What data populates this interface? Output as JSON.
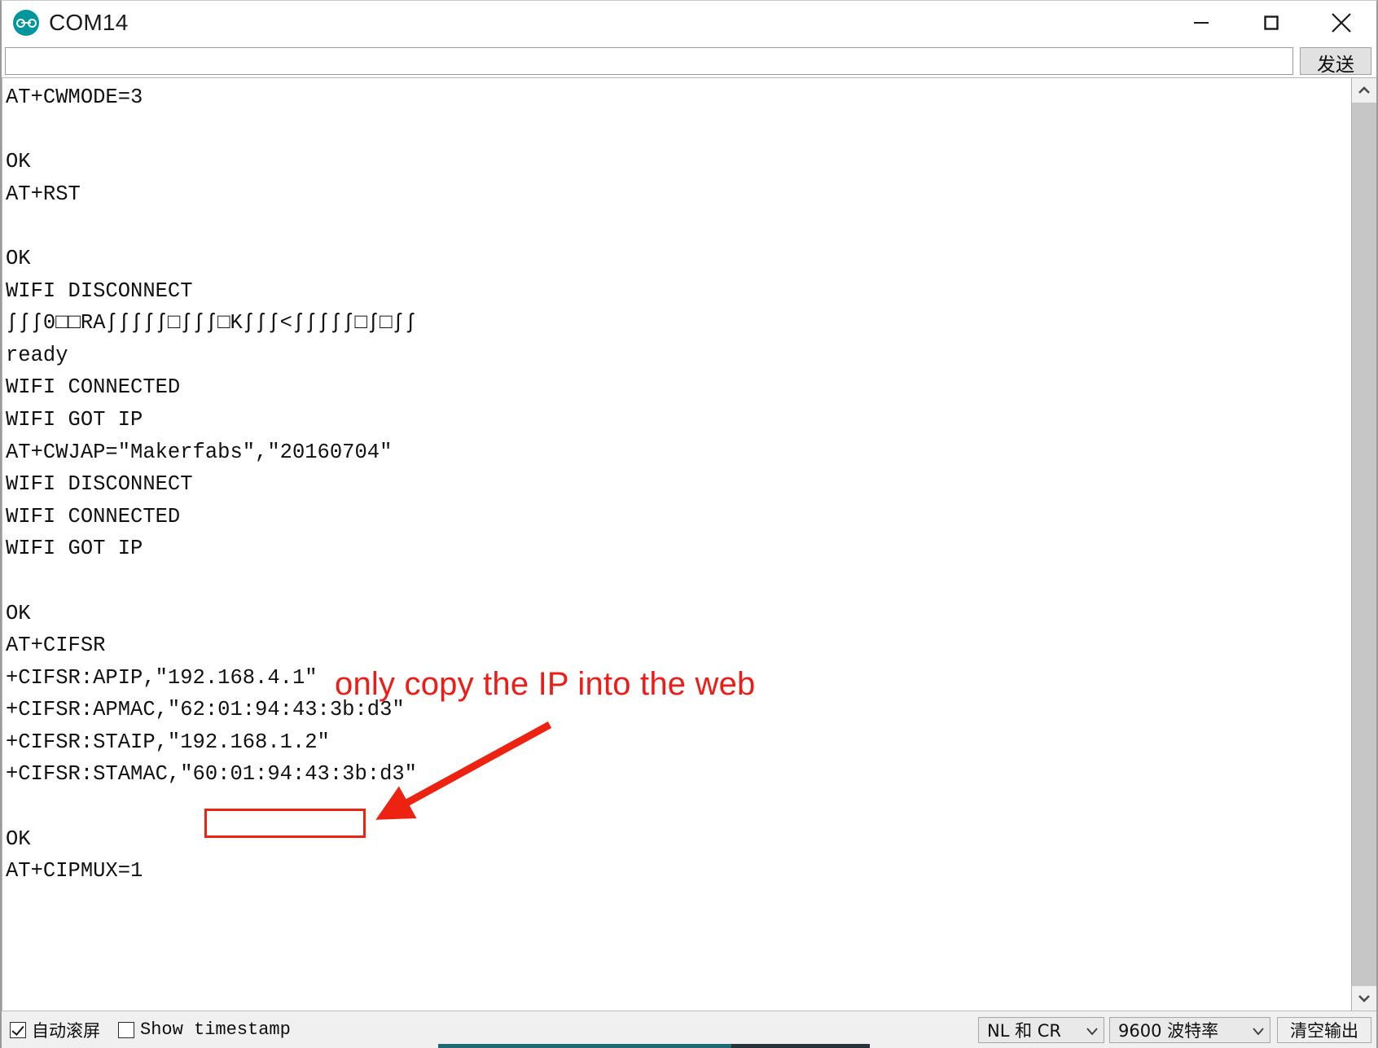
{
  "window": {
    "title": "COM14",
    "logo_icon": "arduino-infinity-icon",
    "minimize_icon": "minimize-icon",
    "maximize_icon": "maximize-icon",
    "close_icon": "close-icon"
  },
  "send_row": {
    "input_value": "",
    "input_placeholder": "",
    "send_label": "发送"
  },
  "console": {
    "lines": [
      "AT+CWMODE=3",
      "",
      "OK",
      "AT+RST",
      "",
      "OK",
      "WIFI DISCONNECT",
      "ʃʃʃ0□□RAʃʃʃʃʃ□ʃʃʃ□Kʃʃʃ<ʃʃʃʃʃ□ʃ□ʃʃ",
      "ready",
      "WIFI CONNECTED",
      "WIFI GOT IP",
      "AT+CWJAP=\"Makerfabs\",\"20160704\"",
      "WIFI DISCONNECT",
      "WIFI CONNECTED",
      "WIFI GOT IP",
      "",
      "OK",
      "AT+CIFSR",
      "+CIFSR:APIP,\"192.168.4.1\"",
      "+CIFSR:APMAC,\"62:01:94:43:3b:d3\"",
      "+CIFSR:STAIP,\"192.168.1.2\"",
      "+CIFSR:STAMAC,\"60:01:94:43:3b:d3\"",
      "",
      "OK",
      "AT+CIPMUX=1",
      ""
    ],
    "text": "AT+CWMODE=3\n\nOK\nAT+RST\n\nOK\nWIFI DISCONNECT\nʃʃʃ0□□RAʃʃʃʃʃ□ʃʃʃ□Kʃʃʃ<ʃʃʃʃʃ□ʃ□ʃʃ\nready\nWIFI CONNECTED\nWIFI GOT IP\nAT+CWJAP=\"Makerfabs\",\"20160704\"\nWIFI DISCONNECT\nWIFI CONNECTED\nWIFI GOT IP\n\nOK\nAT+CIFSR\n+CIFSR:APIP,\"192.168.4.1\"\n+CIFSR:APMAC,\"62:01:94:43:3b:d3\"\n+CIFSR:STAIP,\"192.168.1.2\"\n+CIFSR:STAMAC,\"60:01:94:43:3b:d3\"\n\nOK\nAT+CIPMUX=1\n"
  },
  "annotation": {
    "text": "only copy the IP into the web",
    "color": "#ee1c17",
    "highlighted_value": "192.168.1.2",
    "arrow_icon": "arrow-pointing-down-left-icon"
  },
  "scrollbar": {
    "up_icon": "chevron-up-icon",
    "down_icon": "chevron-down-icon"
  },
  "statusbar": {
    "autoscroll_label": "自动滚屏",
    "autoscroll_checked": true,
    "timestamp_label": "Show timestamp",
    "timestamp_checked": false,
    "line_ending": "NL 和 CR",
    "baud_rate": "9600 波特率",
    "clear_label": "清空输出",
    "caret_icon": "chevron-down-icon"
  }
}
